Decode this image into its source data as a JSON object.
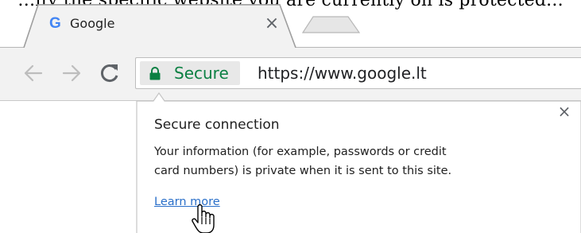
{
  "document": {
    "cutoff_text": "…ify the specific website you are currently on is protected..."
  },
  "tab": {
    "favicon": "G",
    "title": "Google",
    "close_glyph": "×"
  },
  "toolbar": {
    "back_icon": "back-arrow-icon",
    "forward_icon": "forward-arrow-icon",
    "reload_icon": "reload-icon"
  },
  "omnibox": {
    "secure_label": "Secure",
    "url": "https://www.google.lt",
    "secure_color": "#0b8043"
  },
  "popup": {
    "close_glyph": "×",
    "title": "Secure connection",
    "body_lines": [
      "Your information (for example, passwords or credit",
      "card numbers) is private when it is sent to this site."
    ],
    "link": "Learn more",
    "link_color": "#2a6fc9"
  }
}
